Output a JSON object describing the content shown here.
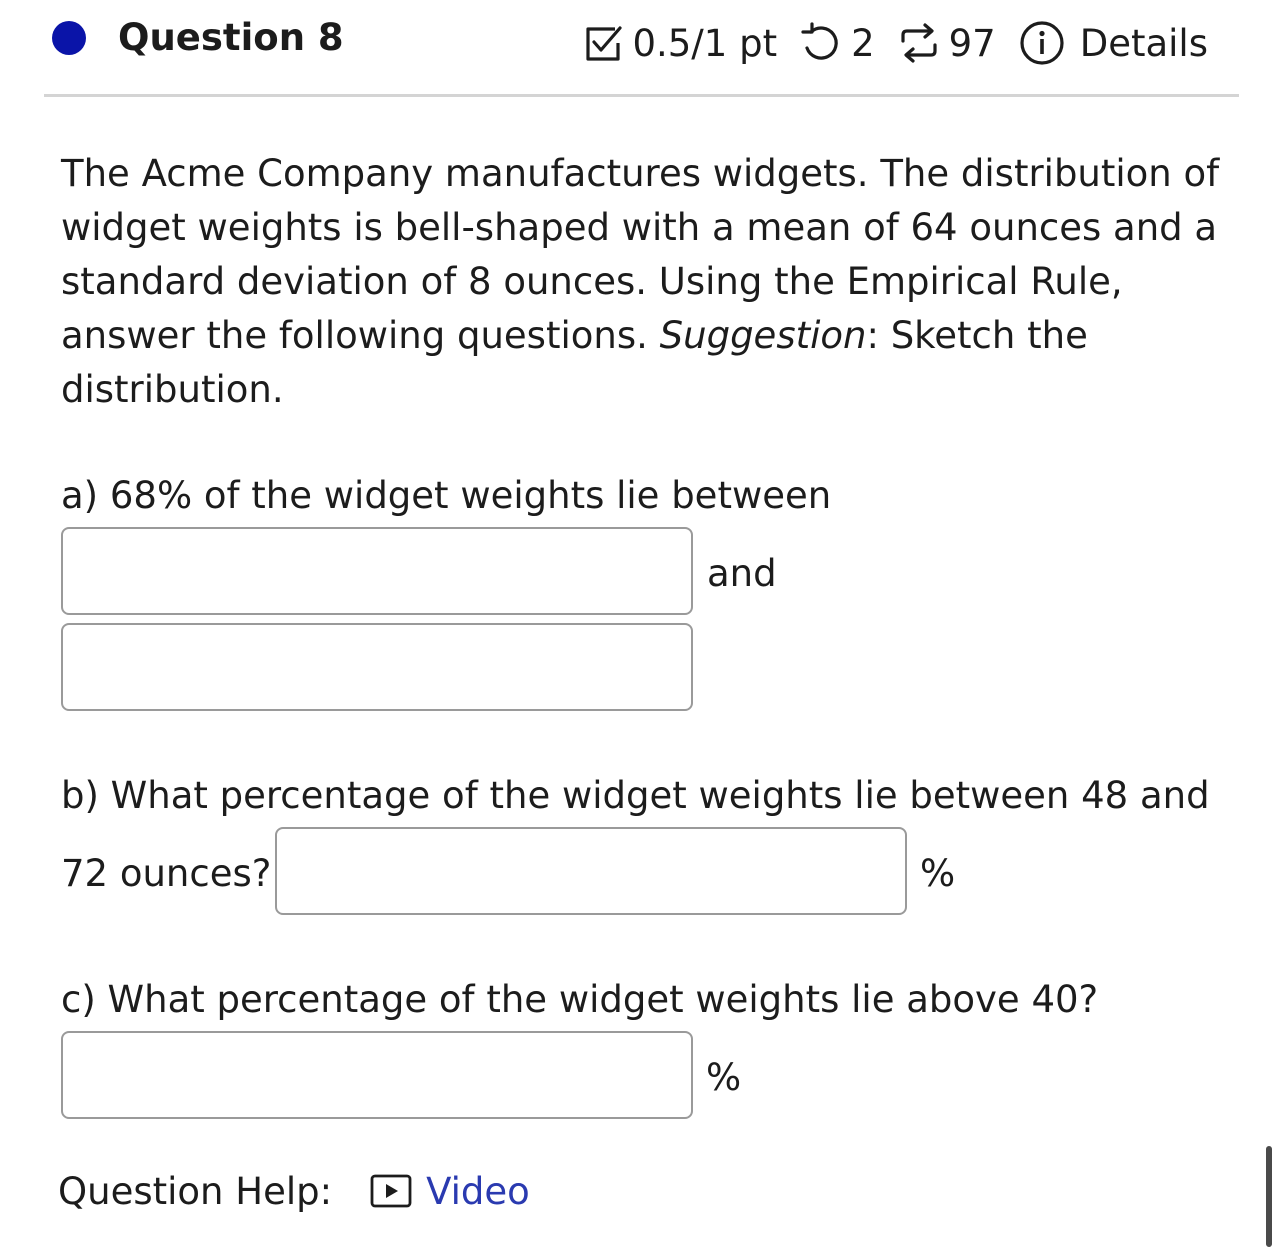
{
  "header": {
    "question_title": "Question 8",
    "score": "0.5/1 pt",
    "retries": "2",
    "attempts": "97",
    "details_label": "Details",
    "status_color": "#0a14a8"
  },
  "prompt": {
    "text_before_em": "The Acme Company manufactures widgets. The distribution of widget weights is bell-shaped with a mean of 64 ounces and a standard deviation of 8 ounces. Using the Empirical Rule, answer the following questions. ",
    "em_word": "Suggestion",
    "text_after_em": ": Sketch the distribution."
  },
  "part_a": {
    "label": "a) 68% of the widget weights lie between",
    "connector": "and",
    "input1_value": "",
    "input2_value": ""
  },
  "part_b": {
    "label_line1": "b) What percentage of the widget weights lie between 48 and",
    "label_line2": "72 ounces?",
    "unit": "%",
    "input_value": ""
  },
  "part_c": {
    "label": "c) What percentage of the widget weights lie above 40?",
    "unit": "%",
    "input_value": ""
  },
  "help": {
    "label": "Question Help:",
    "video_label": "Video",
    "link_color": "#2a3ab0"
  },
  "icons": {
    "score": "checkbox-icon",
    "retries": "retry-icon",
    "attempts": "repeat-icon",
    "details": "info-icon",
    "video": "play-icon"
  }
}
